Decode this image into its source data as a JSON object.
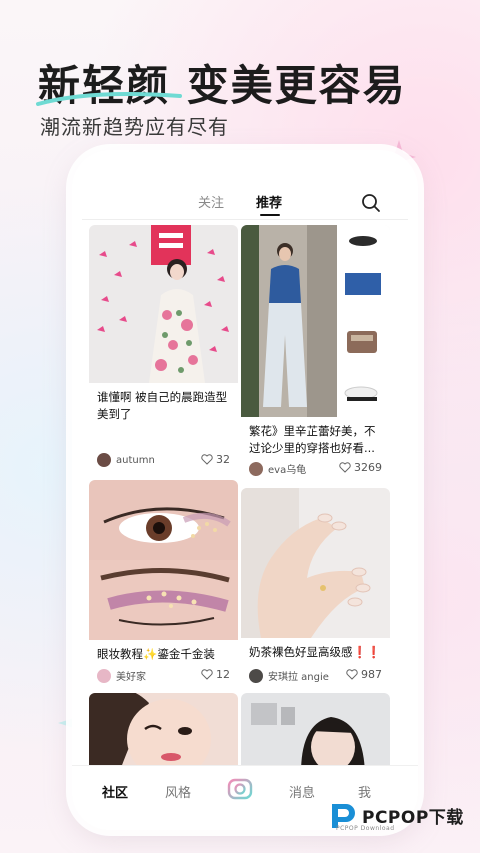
{
  "promo": {
    "headline": "新轻颜 变美更容易",
    "subhead": "潮流新趋势应有尽有"
  },
  "tabs": {
    "follow": "关注",
    "recommend": "推荐"
  },
  "feed": [
    {
      "title": "谁懂啊 被自己的晨跑造型美到了",
      "author": "autumn",
      "likes": "32"
    },
    {
      "title": "繁花》里辛芷蕾好美，不过论少里的穿搭也好看...",
      "author": "eva乌龟",
      "likes": "3269"
    },
    {
      "title": "眼妆教程✨鎏金千金装",
      "author": "美好家",
      "likes": "12"
    },
    {
      "title": "奶茶裸色好显高级感❗❗",
      "author": "安琪拉 angie",
      "likes": "987"
    }
  ],
  "nav": {
    "community": "社区",
    "style": "风格",
    "messages": "消息",
    "me": "我"
  },
  "watermark": {
    "brand": "PCPOP下载",
    "sub": "PCPOP Download"
  }
}
